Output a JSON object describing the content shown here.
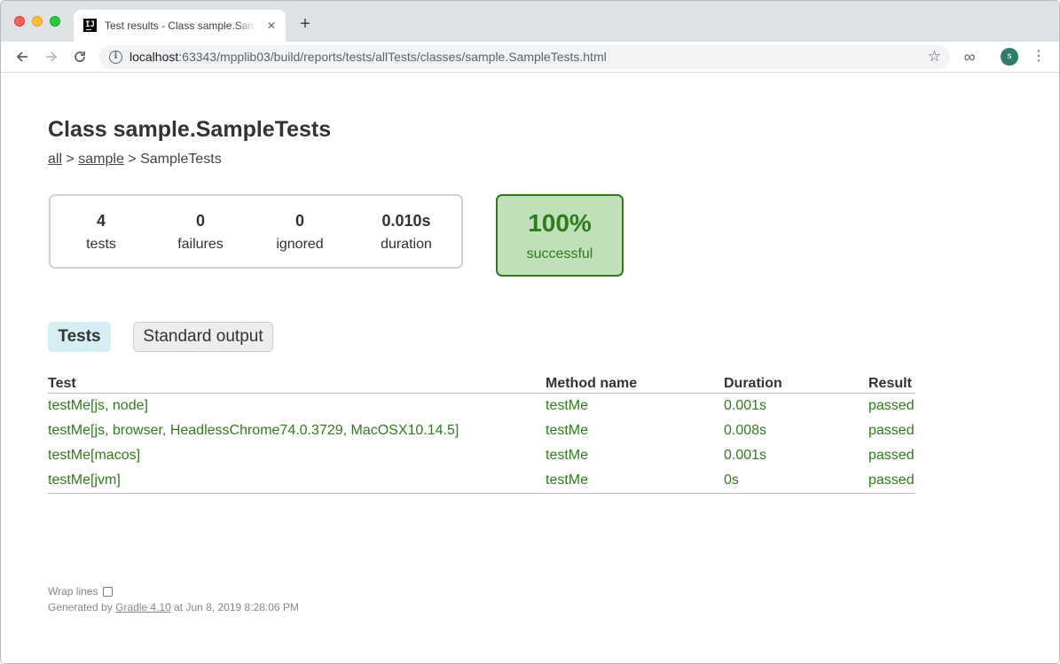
{
  "browser": {
    "tab_title": "Test results - Class sample.SampleTests",
    "tab_favicon": "IJ",
    "tab_close": "✕",
    "new_tab": "+",
    "url_host": "localhost",
    "url_rest": ":63343/mpplib03/build/reports/tests/allTests/classes/sample.SampleTests.html",
    "avatar_initial": "s",
    "icons": {
      "back": "arrow-left-icon",
      "forward": "arrow-right-icon",
      "reload": "reload-icon",
      "info": "info-icon",
      "star": "star-icon",
      "extension": "infinity-extension-icon",
      "menu": "kebab-menu-icon"
    }
  },
  "page": {
    "title": "Class sample.SampleTests",
    "breadcrumb": {
      "all": "all",
      "sep1": ">",
      "sample": "sample",
      "sep2": ">",
      "current": "SampleTests"
    },
    "summary": {
      "tests": "4",
      "tests_label": "tests",
      "failures": "0",
      "failures_label": "failures",
      "ignored": "0",
      "ignored_label": "ignored",
      "duration": "0.010s",
      "duration_label": "duration"
    },
    "success": {
      "percent": "100%",
      "label": "successful",
      "color": "#2e7d1a",
      "bg_color": "#bfe0b8"
    },
    "tabs": [
      {
        "label": "Tests",
        "active": true
      },
      {
        "label": "Standard output",
        "active": false
      }
    ],
    "table": {
      "headers": [
        "Test",
        "Method name",
        "Duration",
        "Result"
      ],
      "rows": [
        {
          "test": "testMe[js, node]",
          "method": "testMe",
          "duration": "0.001s",
          "result": "passed"
        },
        {
          "test": "testMe[js, browser, HeadlessChrome74.0.3729, MacOSX10.14.5]",
          "method": "testMe",
          "duration": "0.008s",
          "result": "passed"
        },
        {
          "test": "testMe[macos]",
          "method": "testMe",
          "duration": "0.001s",
          "result": "passed"
        },
        {
          "test": "testMe[jvm]",
          "method": "testMe",
          "duration": "0s",
          "result": "passed"
        }
      ]
    },
    "footer": {
      "wrap_lines": "Wrap lines",
      "generated_by": "Generated by",
      "gradle_link": "Gradle 4.10",
      "generated_at": "at Jun 8, 2019 8:28:06 PM"
    }
  }
}
